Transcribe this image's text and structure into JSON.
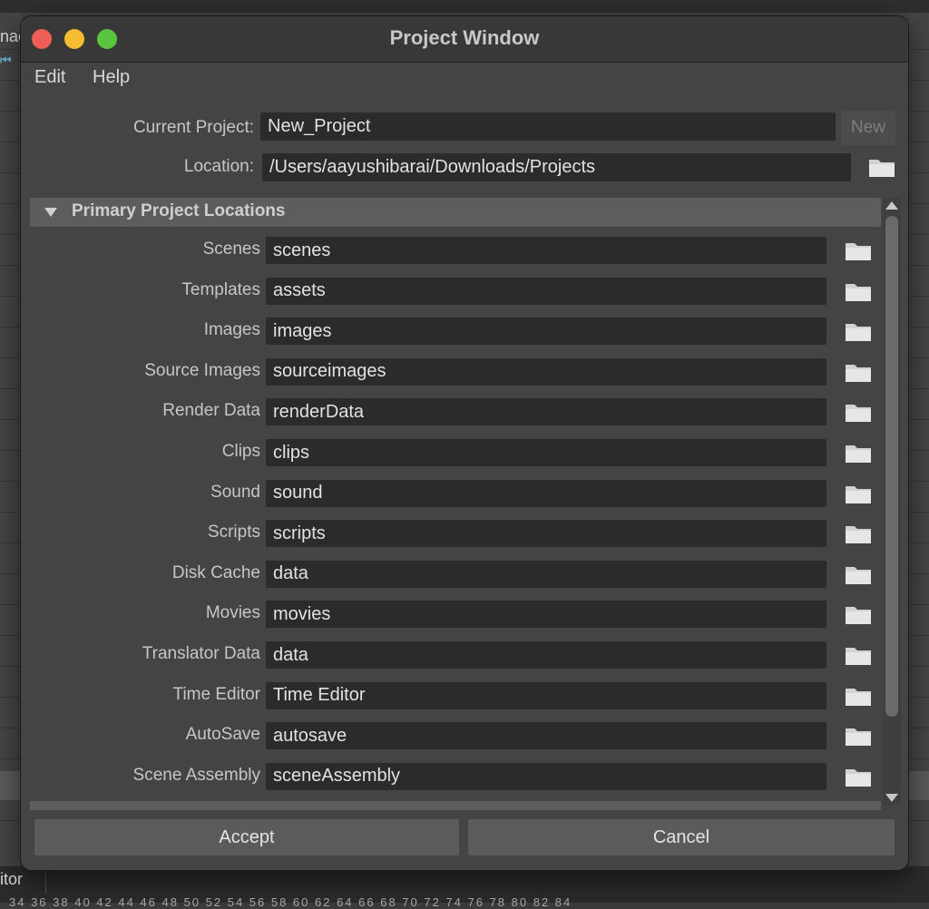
{
  "background": {
    "fragment_top": "nac",
    "fragment_bottom": "itor",
    "ruler": "34 36 38 40 42 44 46 48 50 52 54 56 58 60 62 64 66 68 70 72 74 76 78 80 82 84"
  },
  "window": {
    "title": "Project Window",
    "menu": [
      "Edit",
      "Help"
    ]
  },
  "project": {
    "current_label": "Current Project:",
    "current_value": "New_Project",
    "new_label": "New",
    "location_label": "Location:",
    "location_value": "/Users/aayushibarai/Downloads/Projects"
  },
  "section": {
    "title": "Primary Project Locations",
    "rows": [
      {
        "label": "Scenes",
        "value": "scenes"
      },
      {
        "label": "Templates",
        "value": "assets"
      },
      {
        "label": "Images",
        "value": "images"
      },
      {
        "label": "Source Images",
        "value": "sourceimages"
      },
      {
        "label": "Render Data",
        "value": "renderData"
      },
      {
        "label": "Clips",
        "value": "clips"
      },
      {
        "label": "Sound",
        "value": "sound"
      },
      {
        "label": "Scripts",
        "value": "scripts"
      },
      {
        "label": "Disk Cache",
        "value": "data"
      },
      {
        "label": "Movies",
        "value": "movies"
      },
      {
        "label": "Translator Data",
        "value": "data"
      },
      {
        "label": "Time Editor",
        "value": "Time Editor"
      },
      {
        "label": "AutoSave",
        "value": "autosave"
      },
      {
        "label": "Scene Assembly",
        "value": "sceneAssembly"
      }
    ]
  },
  "footer": {
    "accept_label": "Accept",
    "cancel_label": "Cancel"
  },
  "icons": {
    "folder": "folder-icon",
    "disclosure": "triangle-down-icon"
  },
  "colors": {
    "close": "#ee5e57",
    "minimize": "#f5bd31",
    "maximize": "#5ac43f"
  }
}
